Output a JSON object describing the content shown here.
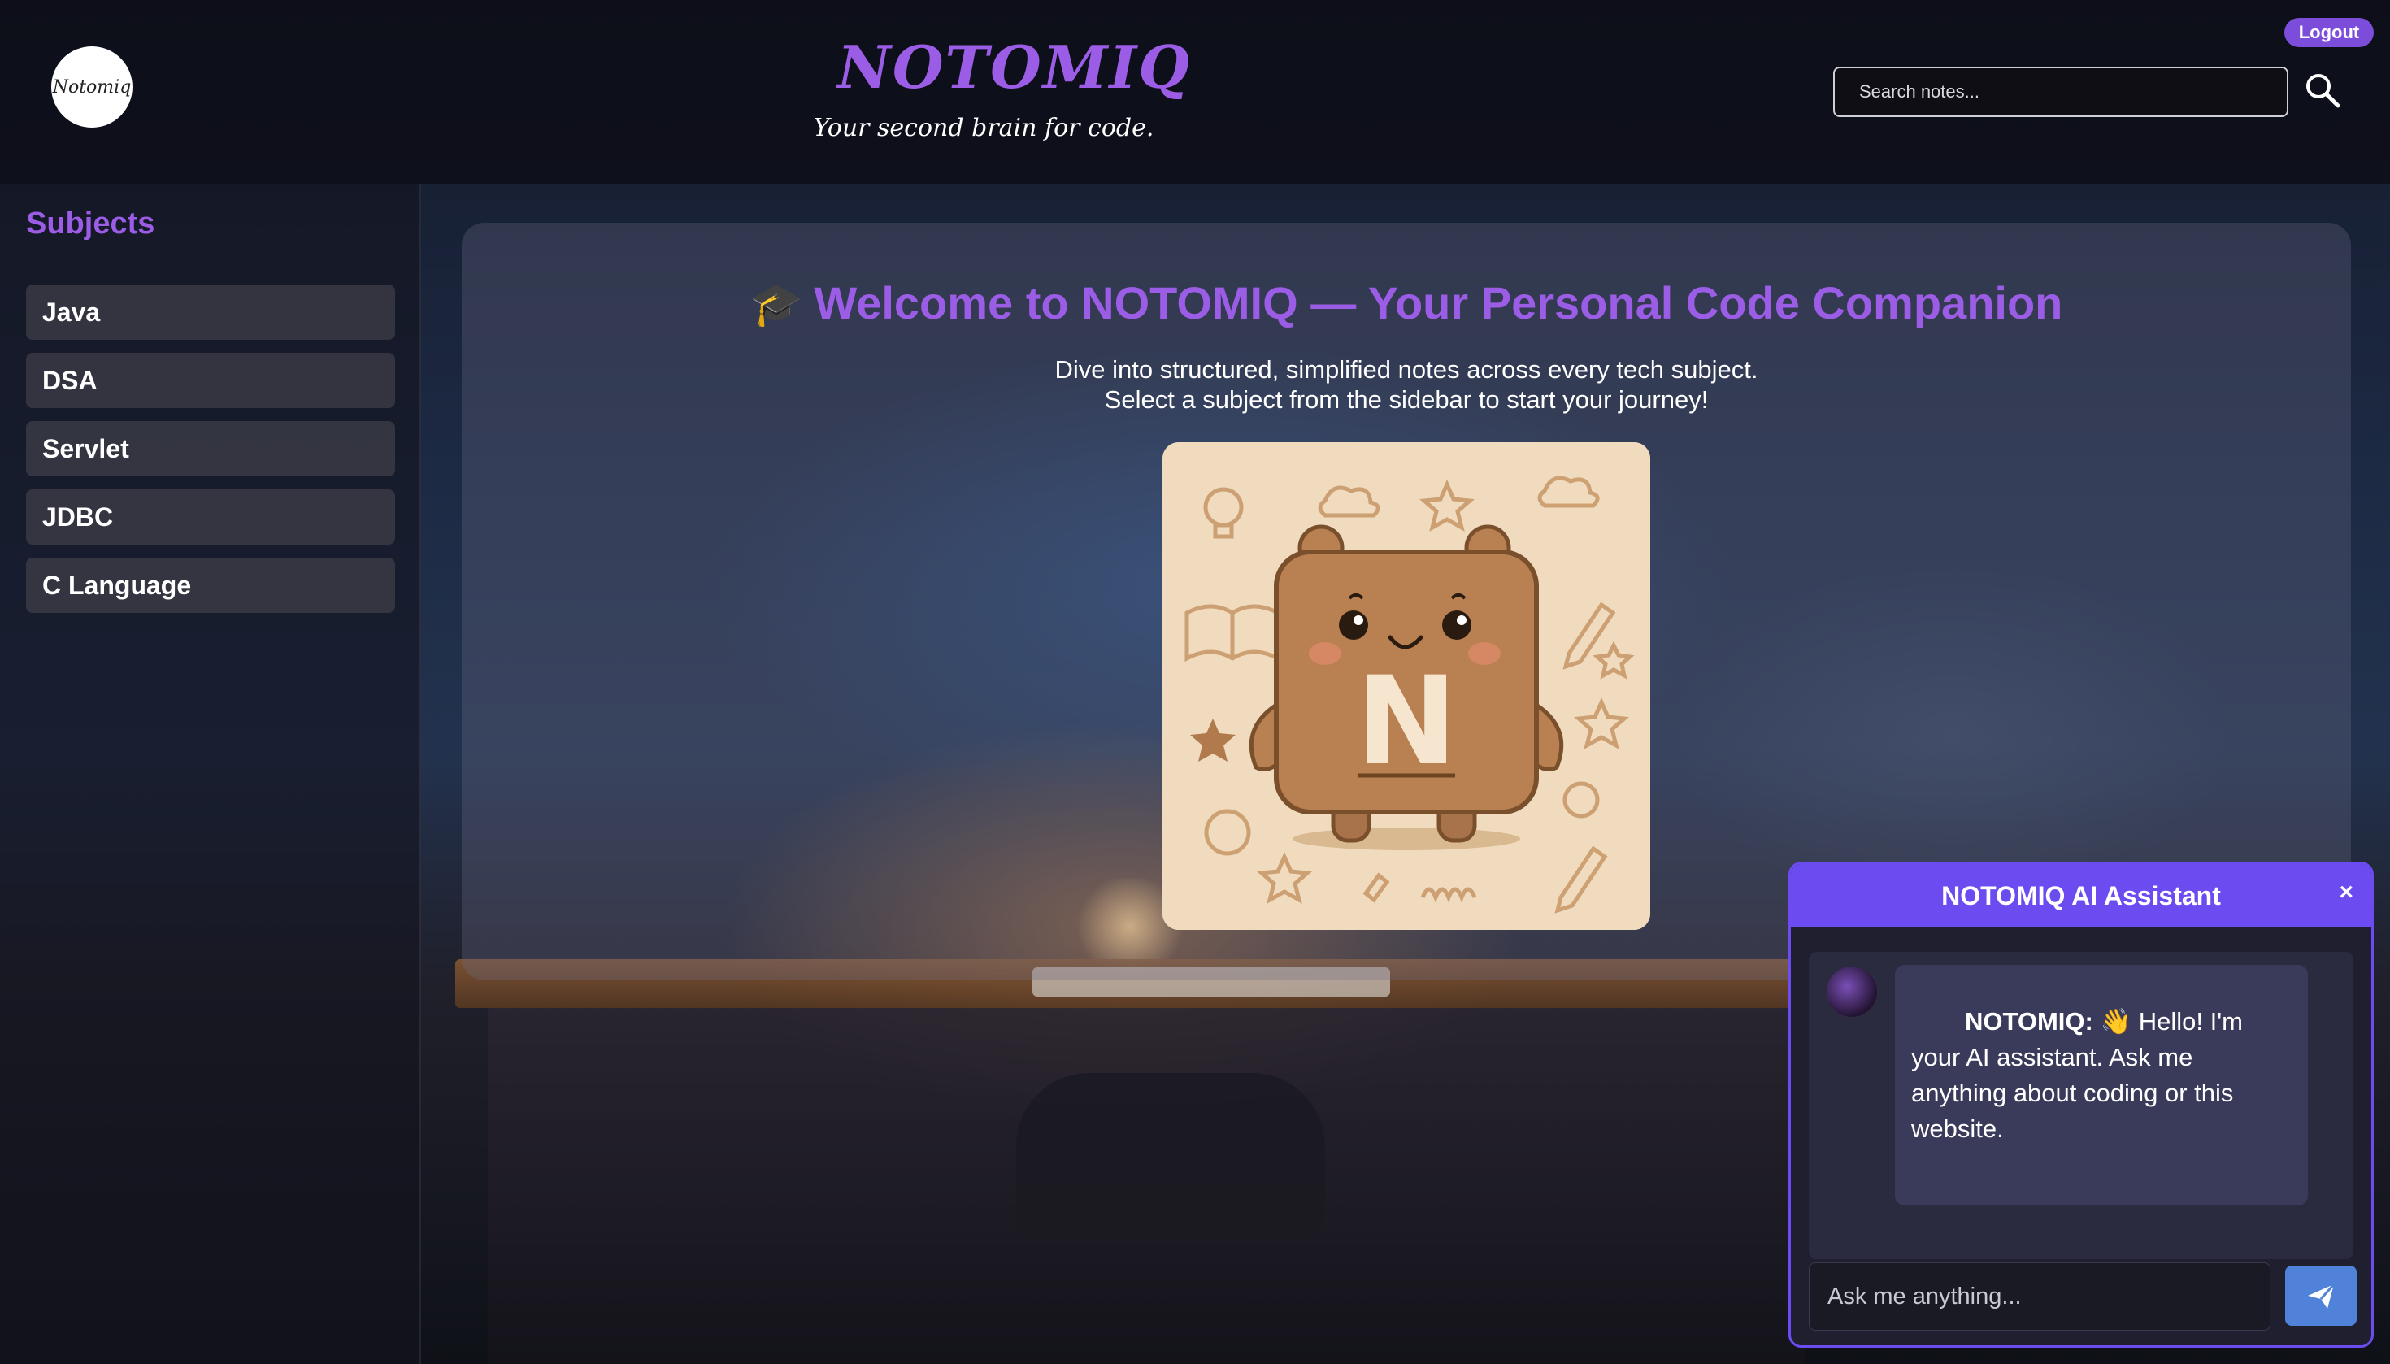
{
  "header": {
    "logo_text": "Notomiq",
    "brand_title": "NOTOMIQ",
    "tagline": "Your second brain for code.",
    "logout_label": "Logout",
    "search_placeholder": "Search notes...",
    "search_icon": "search-icon"
  },
  "sidebar": {
    "title": "Subjects",
    "items": [
      {
        "label": "Java"
      },
      {
        "label": "DSA"
      },
      {
        "label": "Servlet"
      },
      {
        "label": "JDBC"
      },
      {
        "label": "C Language"
      }
    ]
  },
  "main": {
    "cap_icon": "🎓",
    "title": "Welcome to NOTOMIQ — Your Personal Code Companion",
    "subtitle_line1": "Dive into structured, simplified notes across every tech subject.",
    "subtitle_line2": "Select a subject from the sidebar to start your journey!",
    "mascot_letter": "N"
  },
  "chat": {
    "title": "NOTOMIQ AI Assistant",
    "close_label": "×",
    "bot_name": "NOTOMIQ:",
    "bot_message": "👋 Hello! I'm your AI assistant. Ask me anything about coding or this website.",
    "input_placeholder": "Ask me anything..."
  },
  "colors": {
    "accent": "#9b5de5",
    "chat_accent": "#6c4cf0",
    "send_button": "#4f82d8"
  }
}
